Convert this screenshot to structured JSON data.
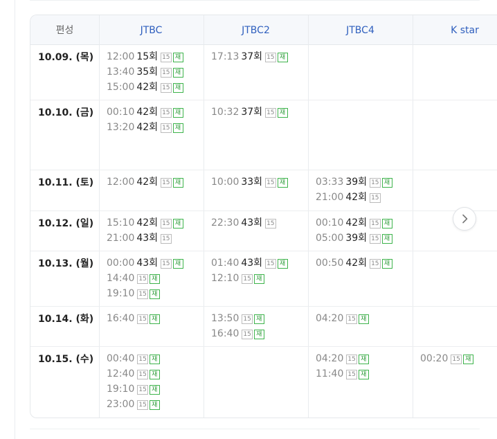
{
  "header": {
    "label": "편성",
    "channels": [
      "JTBC",
      "JTBC2",
      "JTBC4",
      "K star"
    ]
  },
  "badges": {
    "rating": "15",
    "rerun": "재"
  },
  "rows": [
    {
      "date": "10.09. (목)",
      "cells": [
        [
          {
            "time": "12:00",
            "ep": "15회",
            "rerun": true
          },
          {
            "time": "13:40",
            "ep": "35회",
            "rerun": true
          },
          {
            "time": "15:00",
            "ep": "42회",
            "rerun": true
          }
        ],
        [
          {
            "time": "17:13",
            "ep": "37회",
            "rerun": true
          }
        ],
        [],
        []
      ]
    },
    {
      "date": "10.10. (금)",
      "cells": [
        [
          {
            "time": "00:10",
            "ep": "42회",
            "rerun": true
          },
          {
            "time": "13:20",
            "ep": "42회",
            "rerun": true
          }
        ],
        [
          {
            "time": "10:32",
            "ep": "37회",
            "rerun": true
          }
        ],
        [],
        []
      ]
    },
    {
      "date": "10.11. (토)",
      "cells": [
        [
          {
            "time": "12:00",
            "ep": "42회",
            "rerun": true
          }
        ],
        [
          {
            "time": "10:00",
            "ep": "33회",
            "rerun": true
          }
        ],
        [
          {
            "time": "03:33",
            "ep": "39회",
            "rerun": true
          },
          {
            "time": "21:00",
            "ep": "42회",
            "rerun": false
          }
        ],
        []
      ]
    },
    {
      "date": "10.12. (일)",
      "cells": [
        [
          {
            "time": "15:10",
            "ep": "42회",
            "rerun": true
          },
          {
            "time": "21:00",
            "ep": "43회",
            "rerun": false
          }
        ],
        [
          {
            "time": "22:30",
            "ep": "43회",
            "rerun": false
          }
        ],
        [
          {
            "time": "00:10",
            "ep": "42회",
            "rerun": true
          },
          {
            "time": "05:00",
            "ep": "39회",
            "rerun": true
          }
        ],
        []
      ]
    },
    {
      "date": "10.13. (월)",
      "cells": [
        [
          {
            "time": "00:00",
            "ep": "43회",
            "rerun": true
          },
          {
            "time": "14:40",
            "ep": "",
            "rerun": true
          },
          {
            "time": "19:10",
            "ep": "",
            "rerun": true
          }
        ],
        [
          {
            "time": "01:40",
            "ep": "43회",
            "rerun": true
          },
          {
            "time": "12:10",
            "ep": "",
            "rerun": true
          }
        ],
        [
          {
            "time": "00:50",
            "ep": "42회",
            "rerun": true
          }
        ],
        []
      ]
    },
    {
      "date": "10.14. (화)",
      "cells": [
        [
          {
            "time": "16:40",
            "ep": "",
            "rerun": true
          }
        ],
        [
          {
            "time": "13:50",
            "ep": "",
            "rerun": true
          },
          {
            "time": "16:40",
            "ep": "",
            "rerun": true
          }
        ],
        [
          {
            "time": "04:20",
            "ep": "",
            "rerun": true
          }
        ],
        []
      ]
    },
    {
      "date": "10.15. (수)",
      "cells": [
        [
          {
            "time": "00:40",
            "ep": "",
            "rerun": true
          },
          {
            "time": "12:40",
            "ep": "",
            "rerun": true
          },
          {
            "time": "19:10",
            "ep": "",
            "rerun": true
          },
          {
            "time": "23:00",
            "ep": "",
            "rerun": true
          }
        ],
        [],
        [
          {
            "time": "04:20",
            "ep": "",
            "rerun": true
          },
          {
            "time": "11:40",
            "ep": "",
            "rerun": true
          }
        ],
        [
          {
            "time": "00:20",
            "ep": "",
            "rerun": true
          }
        ]
      ]
    }
  ],
  "next_button_icon": "chevron-right-icon"
}
